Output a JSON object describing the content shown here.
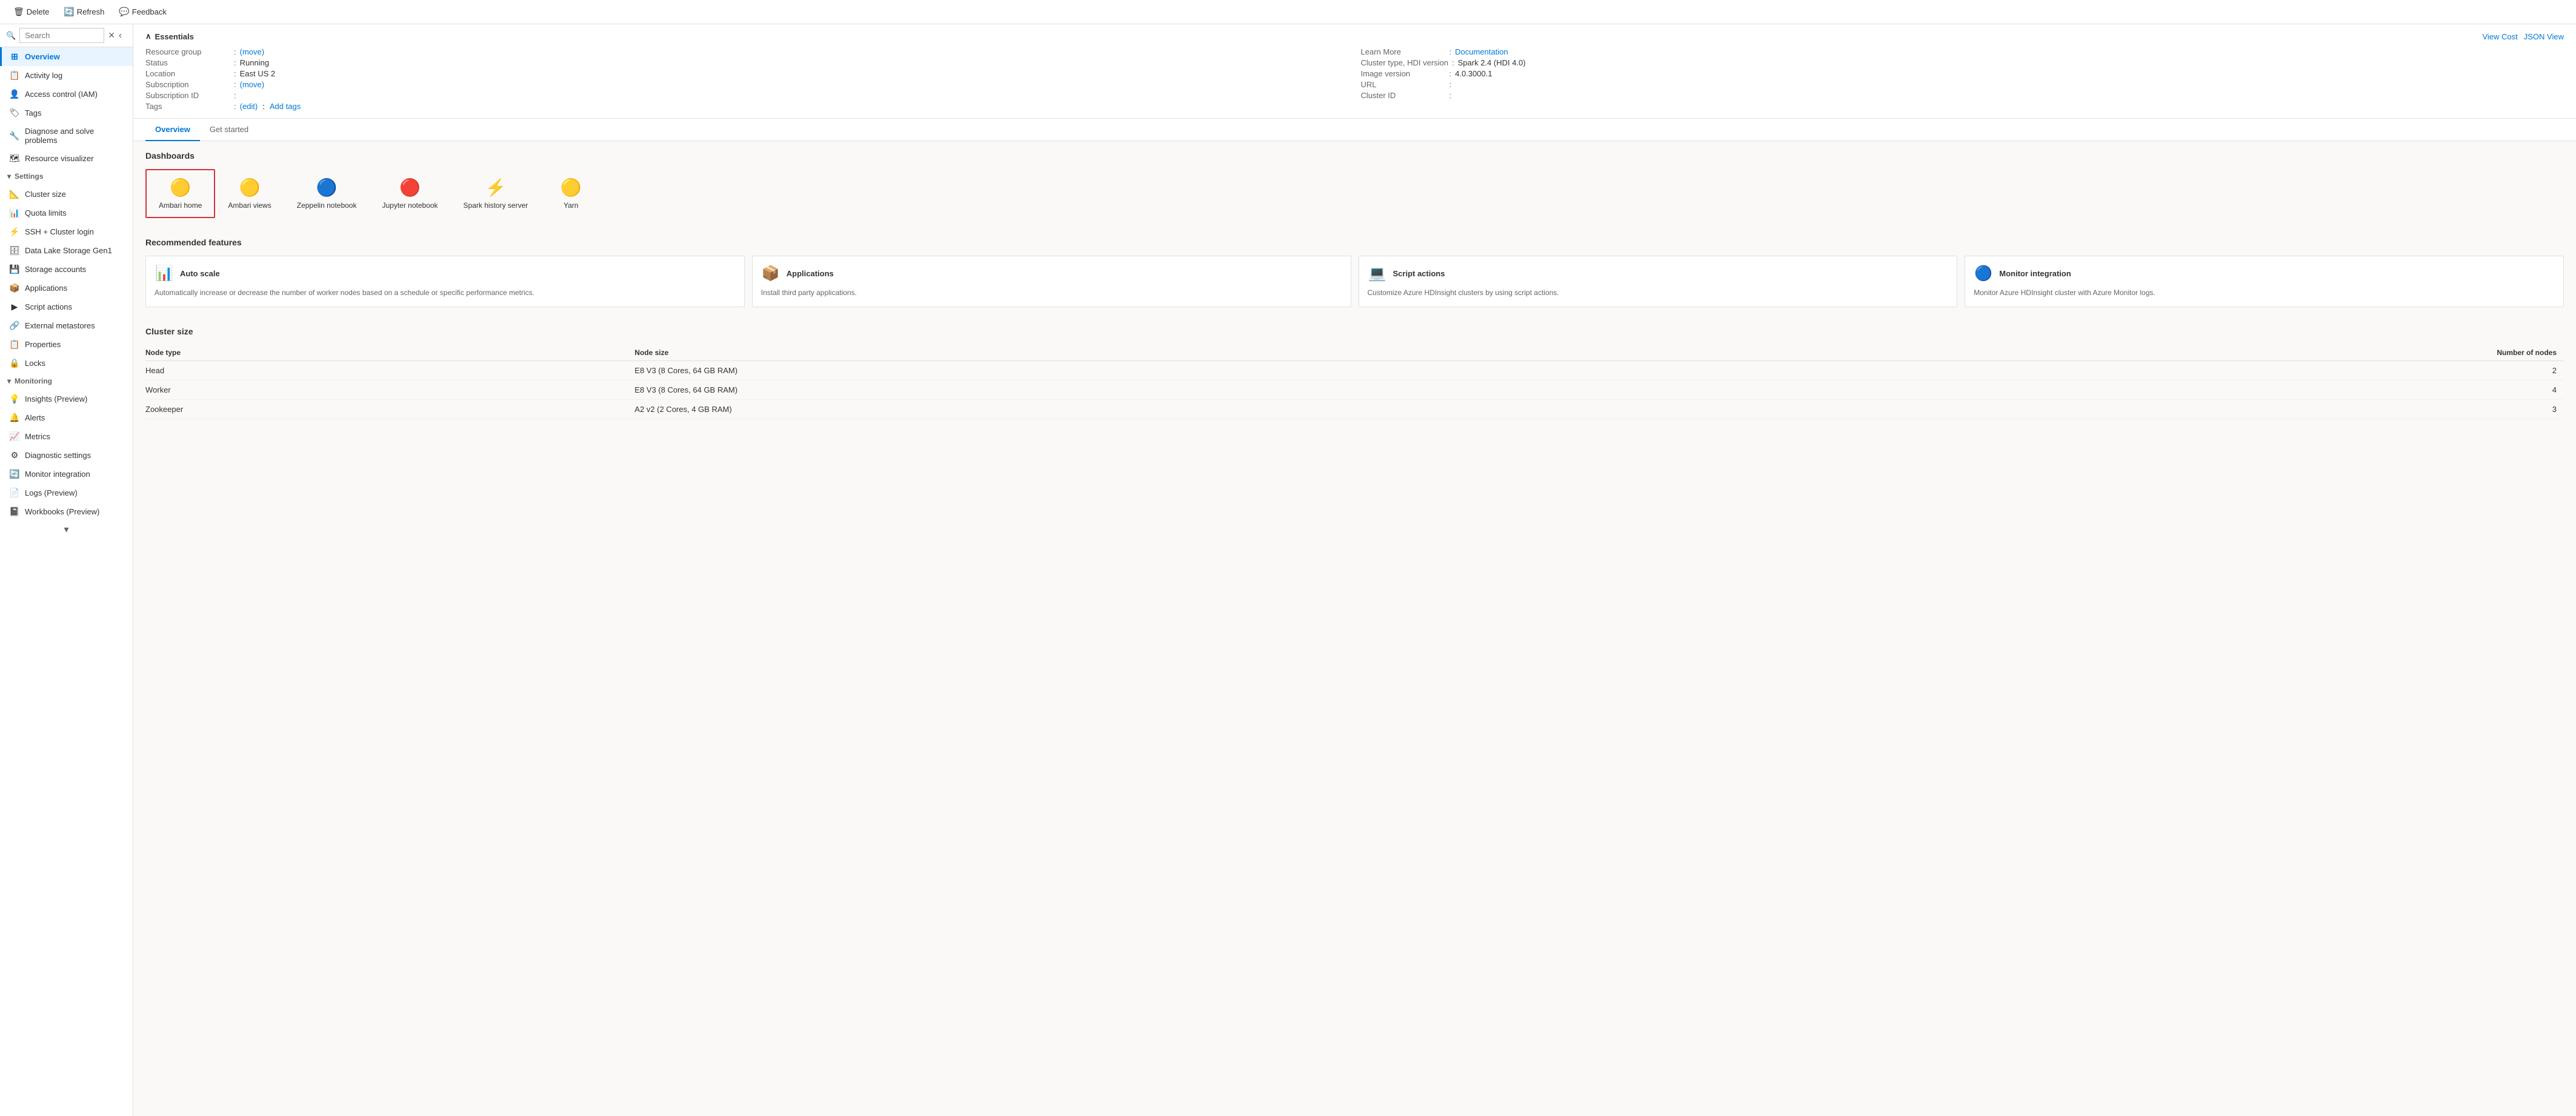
{
  "toolbar": {
    "delete_label": "Delete",
    "refresh_label": "Refresh",
    "feedback_label": "Feedback"
  },
  "sidebar": {
    "search_placeholder": "Search",
    "items": [
      {
        "id": "overview",
        "label": "Overview",
        "icon": "⊞",
        "active": true
      },
      {
        "id": "activity-log",
        "label": "Activity log",
        "icon": "📋"
      },
      {
        "id": "access-control",
        "label": "Access control (IAM)",
        "icon": "👤"
      },
      {
        "id": "tags",
        "label": "Tags",
        "icon": "🏷"
      },
      {
        "id": "diagnose",
        "label": "Diagnose and solve problems",
        "icon": "🔧"
      },
      {
        "id": "resource-visualizer",
        "label": "Resource visualizer",
        "icon": "🗺"
      }
    ],
    "settings_section": "Settings",
    "settings_items": [
      {
        "id": "cluster-size",
        "label": "Cluster size",
        "icon": "📐"
      },
      {
        "id": "quota-limits",
        "label": "Quota limits",
        "icon": "📊"
      },
      {
        "id": "ssh-login",
        "label": "SSH + Cluster login",
        "icon": "⚡"
      },
      {
        "id": "data-lake",
        "label": "Data Lake Storage Gen1",
        "icon": "🗄"
      },
      {
        "id": "storage-accounts",
        "label": "Storage accounts",
        "icon": "💾"
      },
      {
        "id": "applications",
        "label": "Applications",
        "icon": "📦"
      },
      {
        "id": "script-actions",
        "label": "Script actions",
        "icon": "▶"
      },
      {
        "id": "external-metastores",
        "label": "External metastores",
        "icon": "🔗"
      },
      {
        "id": "properties",
        "label": "Properties",
        "icon": "📋"
      },
      {
        "id": "locks",
        "label": "Locks",
        "icon": "🔒"
      }
    ],
    "monitoring_section": "Monitoring",
    "monitoring_items": [
      {
        "id": "insights",
        "label": "Insights (Preview)",
        "icon": "💡"
      },
      {
        "id": "alerts",
        "label": "Alerts",
        "icon": "🔔"
      },
      {
        "id": "metrics",
        "label": "Metrics",
        "icon": "📈"
      },
      {
        "id": "diagnostic-settings",
        "label": "Diagnostic settings",
        "icon": "⚙"
      },
      {
        "id": "monitor-integration",
        "label": "Monitor integration",
        "icon": "🔄"
      },
      {
        "id": "logs-preview",
        "label": "Logs (Preview)",
        "icon": "📄"
      },
      {
        "id": "workbooks-preview",
        "label": "Workbooks (Preview)",
        "icon": "📓"
      }
    ]
  },
  "essentials": {
    "title": "Essentials",
    "view_cost": "View Cost",
    "json_view": "JSON View",
    "left_fields": [
      {
        "label": "Resource group",
        "value": "(move)",
        "is_link": true,
        "colon": true,
        "extra": ""
      },
      {
        "label": "Status",
        "value": "Running",
        "is_link": false,
        "colon": true
      },
      {
        "label": "Location",
        "value": "East US 2",
        "is_link": false,
        "colon": true
      },
      {
        "label": "Subscription",
        "value": "(move)",
        "is_link": true,
        "colon": true,
        "extra": ""
      },
      {
        "label": "Subscription ID",
        "value": "",
        "is_link": false,
        "colon": true
      },
      {
        "label": "Tags",
        "value": "(edit)",
        "is_link": true,
        "colon": true,
        "extra": "Add tags"
      }
    ],
    "right_fields": [
      {
        "label": "Learn More",
        "value": "Documentation",
        "is_link": true,
        "colon": true
      },
      {
        "label": "Cluster type, HDI version",
        "value": "Spark 2.4 (HDI 4.0)",
        "is_link": false,
        "colon": true
      },
      {
        "label": "Image version",
        "value": "4.0.3000.1",
        "is_link": false,
        "colon": true
      },
      {
        "label": "URL",
        "value": "",
        "is_link": false,
        "colon": true
      },
      {
        "label": "Cluster ID",
        "value": "",
        "is_link": false,
        "colon": true
      }
    ]
  },
  "tabs": [
    {
      "id": "overview",
      "label": "Overview",
      "active": true
    },
    {
      "id": "get-started",
      "label": "Get started",
      "active": false
    }
  ],
  "dashboards": {
    "title": "Dashboards",
    "items": [
      {
        "id": "ambari-home",
        "label": "Ambari home",
        "icon": "🟡",
        "highlighted": true
      },
      {
        "id": "ambari-views",
        "label": "Ambari views",
        "icon": "🟡",
        "highlighted": false
      },
      {
        "id": "zeppelin-notebook",
        "label": "Zeppelin notebook",
        "icon": "🔵",
        "highlighted": false
      },
      {
        "id": "jupyter-notebook",
        "label": "Jupyter notebook",
        "icon": "🔴",
        "highlighted": false
      },
      {
        "id": "spark-history",
        "label": "Spark history server",
        "icon": "⚡",
        "highlighted": false
      },
      {
        "id": "yarn",
        "label": "Yarn",
        "icon": "🟡",
        "highlighted": false
      }
    ]
  },
  "recommended": {
    "title": "Recommended features",
    "cards": [
      {
        "id": "auto-scale",
        "icon": "📊",
        "title": "Auto scale",
        "description": "Automatically increase or decrease the number of worker nodes based on a schedule or specific performance metrics."
      },
      {
        "id": "applications",
        "icon": "📦",
        "title": "Applications",
        "description": "Install third party applications."
      },
      {
        "id": "script-actions",
        "icon": "💻",
        "title": "Script actions",
        "description": "Customize Azure HDInsight clusters by using script actions."
      },
      {
        "id": "monitor-integration",
        "icon": "🔵",
        "title": "Monitor integration",
        "description": "Monitor Azure HDInsight cluster with Azure Monitor logs."
      }
    ]
  },
  "cluster_size": {
    "title": "Cluster size",
    "columns": [
      "Node type",
      "Node size",
      "Number of nodes"
    ],
    "rows": [
      {
        "node_type": "Head",
        "node_size": "E8 V3 (8 Cores, 64 GB RAM)",
        "node_count": "2"
      },
      {
        "node_type": "Worker",
        "node_size": "E8 V3 (8 Cores, 64 GB RAM)",
        "node_count": "4"
      },
      {
        "node_type": "Zookeeper",
        "node_size": "A2 v2 (2 Cores, 4 GB RAM)",
        "node_count": "3"
      }
    ]
  }
}
